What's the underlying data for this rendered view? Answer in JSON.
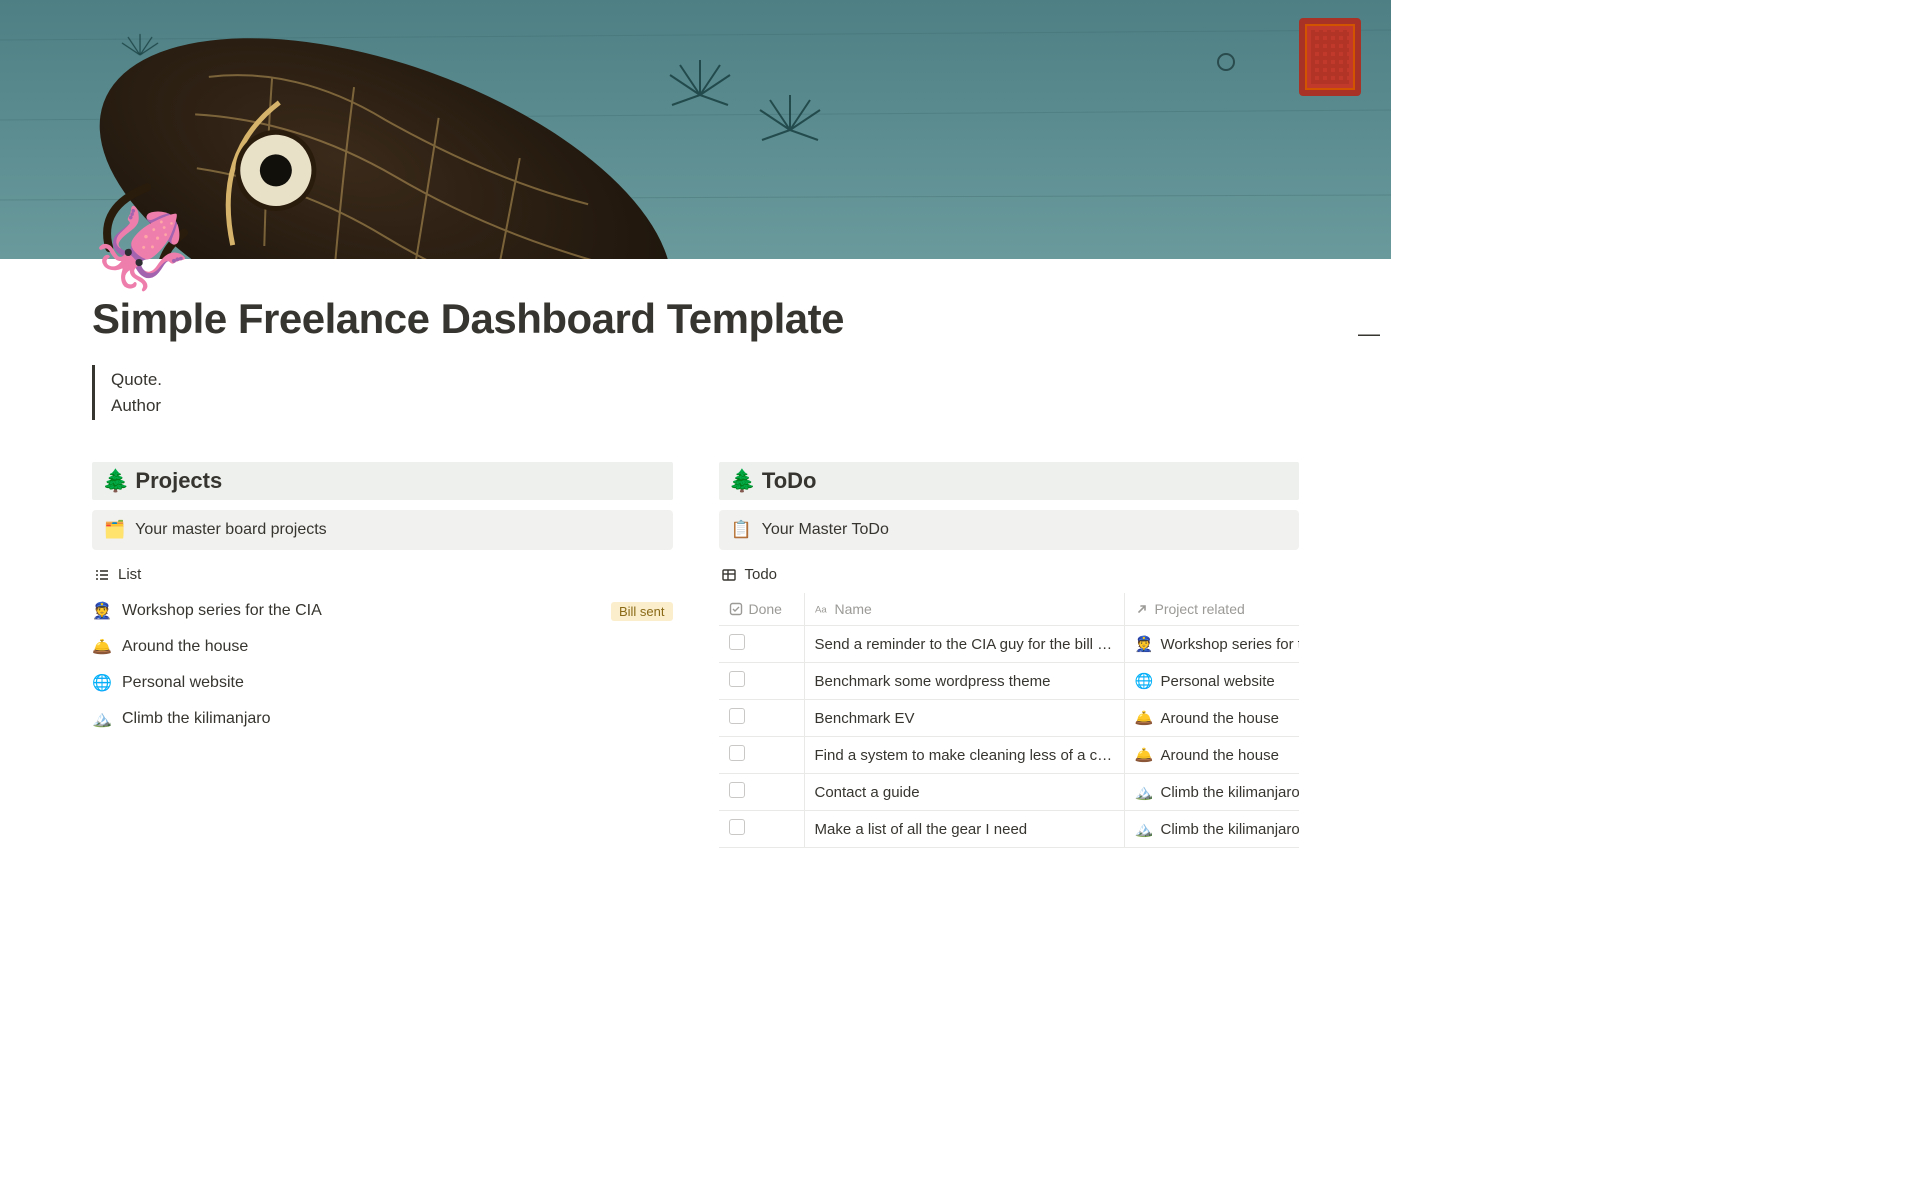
{
  "page": {
    "icon_emoji": "🦑",
    "title": "Simple Freelance Dashboard Template",
    "quote_line1": "Quote.",
    "quote_line2": "Author"
  },
  "projects": {
    "heading_emoji": "🌲",
    "heading": "Projects",
    "callout_emoji": "🗂️",
    "callout_text": "Your master board projects",
    "view_label": "List",
    "items": [
      {
        "emoji": "👮",
        "name": "Workshop series for the CIA",
        "tag": "Bill sent"
      },
      {
        "emoji": "🛎️",
        "name": "Around the house",
        "tag": ""
      },
      {
        "emoji": "🌐",
        "name": "Personal website",
        "tag": ""
      },
      {
        "emoji": "🏔️",
        "name": "Climb the kilimanjaro",
        "tag": ""
      }
    ]
  },
  "todo": {
    "heading_emoji": "🌲",
    "heading": "ToDo",
    "callout_emoji": "📋",
    "callout_text": "Your Master ToDo",
    "view_label": "Todo",
    "columns": {
      "done": "Done",
      "name": "Name",
      "project": "Project related"
    },
    "rows": [
      {
        "name": "Send a reminder to the CIA guy for the bill to be pr",
        "project_emoji": "👮",
        "project": "Workshop series for the"
      },
      {
        "name": "Benchmark some wordpress theme",
        "project_emoji": "🌐",
        "project": "Personal website"
      },
      {
        "name": "Benchmark EV",
        "project_emoji": "🛎️",
        "project": "Around the house"
      },
      {
        "name": "Find a system to make cleaning less of a chore",
        "project_emoji": "🛎️",
        "project": "Around the house"
      },
      {
        "name": "Contact a guide",
        "project_emoji": "🏔️",
        "project": "Climb the kilimanjaro"
      },
      {
        "name": "Make a list of all the gear I need",
        "project_emoji": "🏔️",
        "project": "Climb the kilimanjaro"
      }
    ]
  }
}
